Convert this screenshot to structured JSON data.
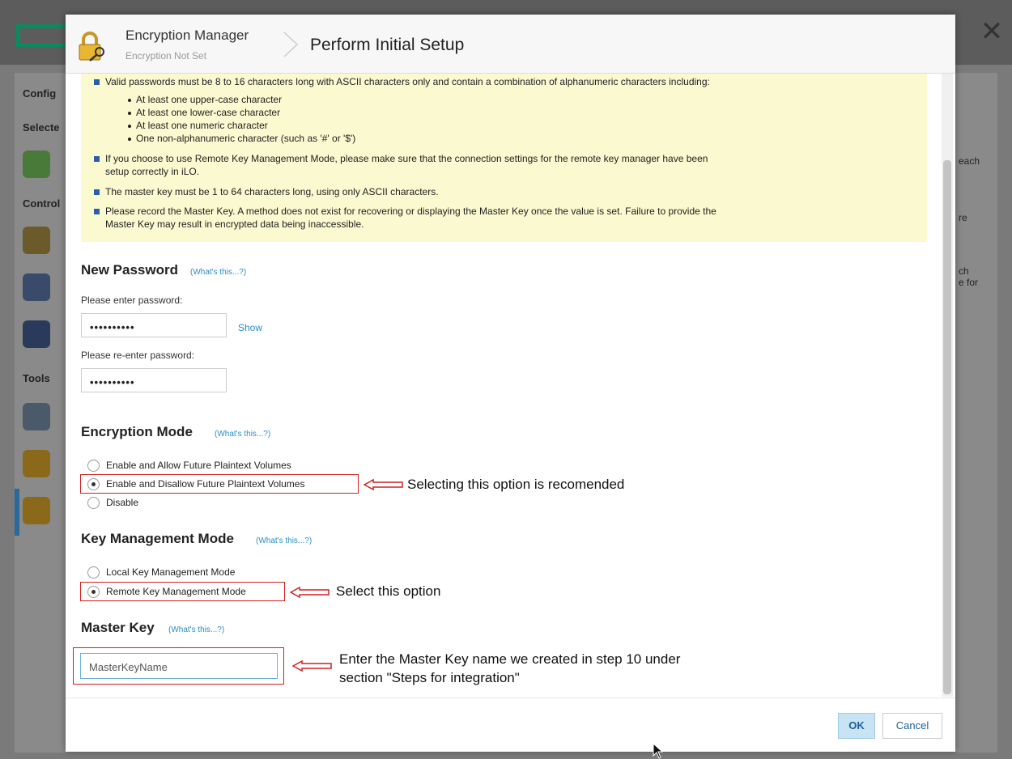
{
  "background": {
    "left_labels": [
      "Config",
      "Selecte",
      "Control",
      "Tools"
    ],
    "right_labels": [
      "each",
      "re",
      "ch\ne for"
    ]
  },
  "header": {
    "title": "Encryption Manager",
    "subtitle": "Encryption Not Set",
    "page_title": "Perform Initial Setup"
  },
  "notes": {
    "password_rule": "Valid passwords must be 8 to 16 characters long with ASCII characters only and contain a combination of alphanumeric characters including:",
    "password_subrules": [
      "At least one upper-case character",
      "At least one lower-case character",
      "At least one numeric character",
      "One non-alphanumeric character (such as '#' or '$')"
    ],
    "remote_line1": "If you choose to use Remote Key Management Mode, please make sure that the connection settings for the remote key manager have been",
    "remote_line2": "setup correctly in iLO.",
    "master_key_rule": "The master key must be 1 to 64 characters long, using only ASCII characters.",
    "record_line1": "Please record the Master Key. A method does not exist for recovering or displaying the Master Key once the value is set. Failure to provide the",
    "record_line2": "Master Key may result in encrypted data being inaccessible."
  },
  "new_password": {
    "title": "New Password",
    "whats_this": "(What's this...?)",
    "enter_label": "Please enter password:",
    "enter_value": "••••••••••",
    "show": "Show",
    "reenter_label": "Please re-enter password:",
    "reenter_value": "••••••••••"
  },
  "encryption_mode": {
    "title": "Encryption Mode",
    "whats_this": "(What's this...?)",
    "options": [
      {
        "label": "Enable and Allow Future Plaintext Volumes",
        "selected": false
      },
      {
        "label": "Enable and Disallow Future Plaintext Volumes",
        "selected": true
      },
      {
        "label": "Disable",
        "selected": false
      }
    ],
    "annotation": "Selecting this option is recomended"
  },
  "key_mode": {
    "title": "Key Management Mode",
    "whats_this": "(What's this...?)",
    "options": [
      {
        "label": "Local Key Management Mode",
        "selected": false
      },
      {
        "label": "Remote Key Management Mode",
        "selected": true
      }
    ],
    "annotation": "Select this option"
  },
  "master_key": {
    "title": "Master Key",
    "whats_this": "(What's this...?)",
    "value": "MasterKeyName",
    "annotation_line1": "Enter the Master Key name we created in step 10 under",
    "annotation_line2": "section \"Steps for integration\""
  },
  "footer": {
    "ok": "OK",
    "cancel": "Cancel"
  },
  "colors": {
    "notes_bg": "#fbf9cf",
    "link": "#2b8cc4",
    "highlight_red": "#d02020",
    "ok_bg": "#c8e3f4"
  }
}
